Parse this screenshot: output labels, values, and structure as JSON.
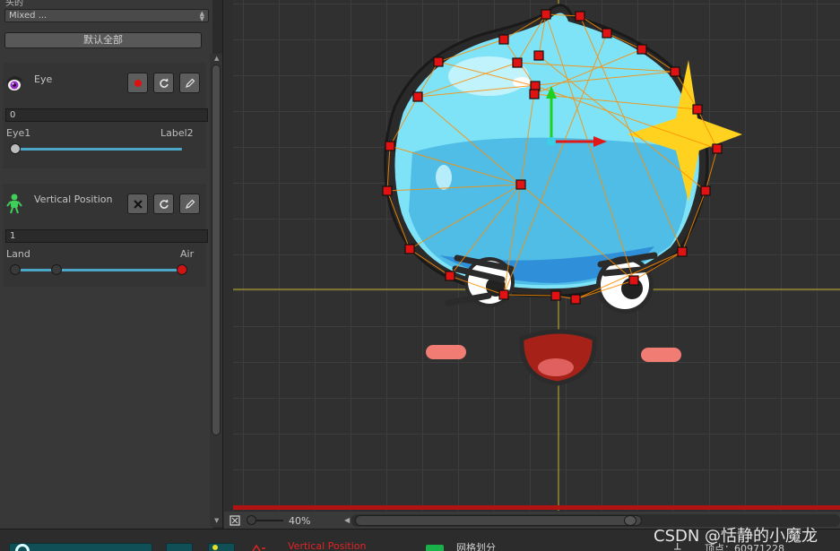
{
  "inspector": {
    "top_cut_label": "头的",
    "mixed_dropdown": "Mixed ...",
    "reset_all_label": "默认全部",
    "eye": {
      "title": "Eye",
      "value": "0",
      "left_label": "Eye1",
      "right_label": "Label2",
      "slider_value": 0
    },
    "vertical_position": {
      "title": "Vertical Position",
      "value": "1",
      "left_label": "Land",
      "right_label": "Air",
      "slider_value": 1
    }
  },
  "viewport": {
    "zoom": "40%"
  },
  "bottom_bar": {
    "vertical_position_label": "Vertical Position",
    "grid_label": "网格划分",
    "vertex_label": "顶点：60971228"
  },
  "watermark": "CSDN @恬静的小魔龙",
  "colors": {
    "accent_slider": "#4ca6c8",
    "selection_red": "#e01212",
    "mesh_orange": "#ff8c00"
  }
}
